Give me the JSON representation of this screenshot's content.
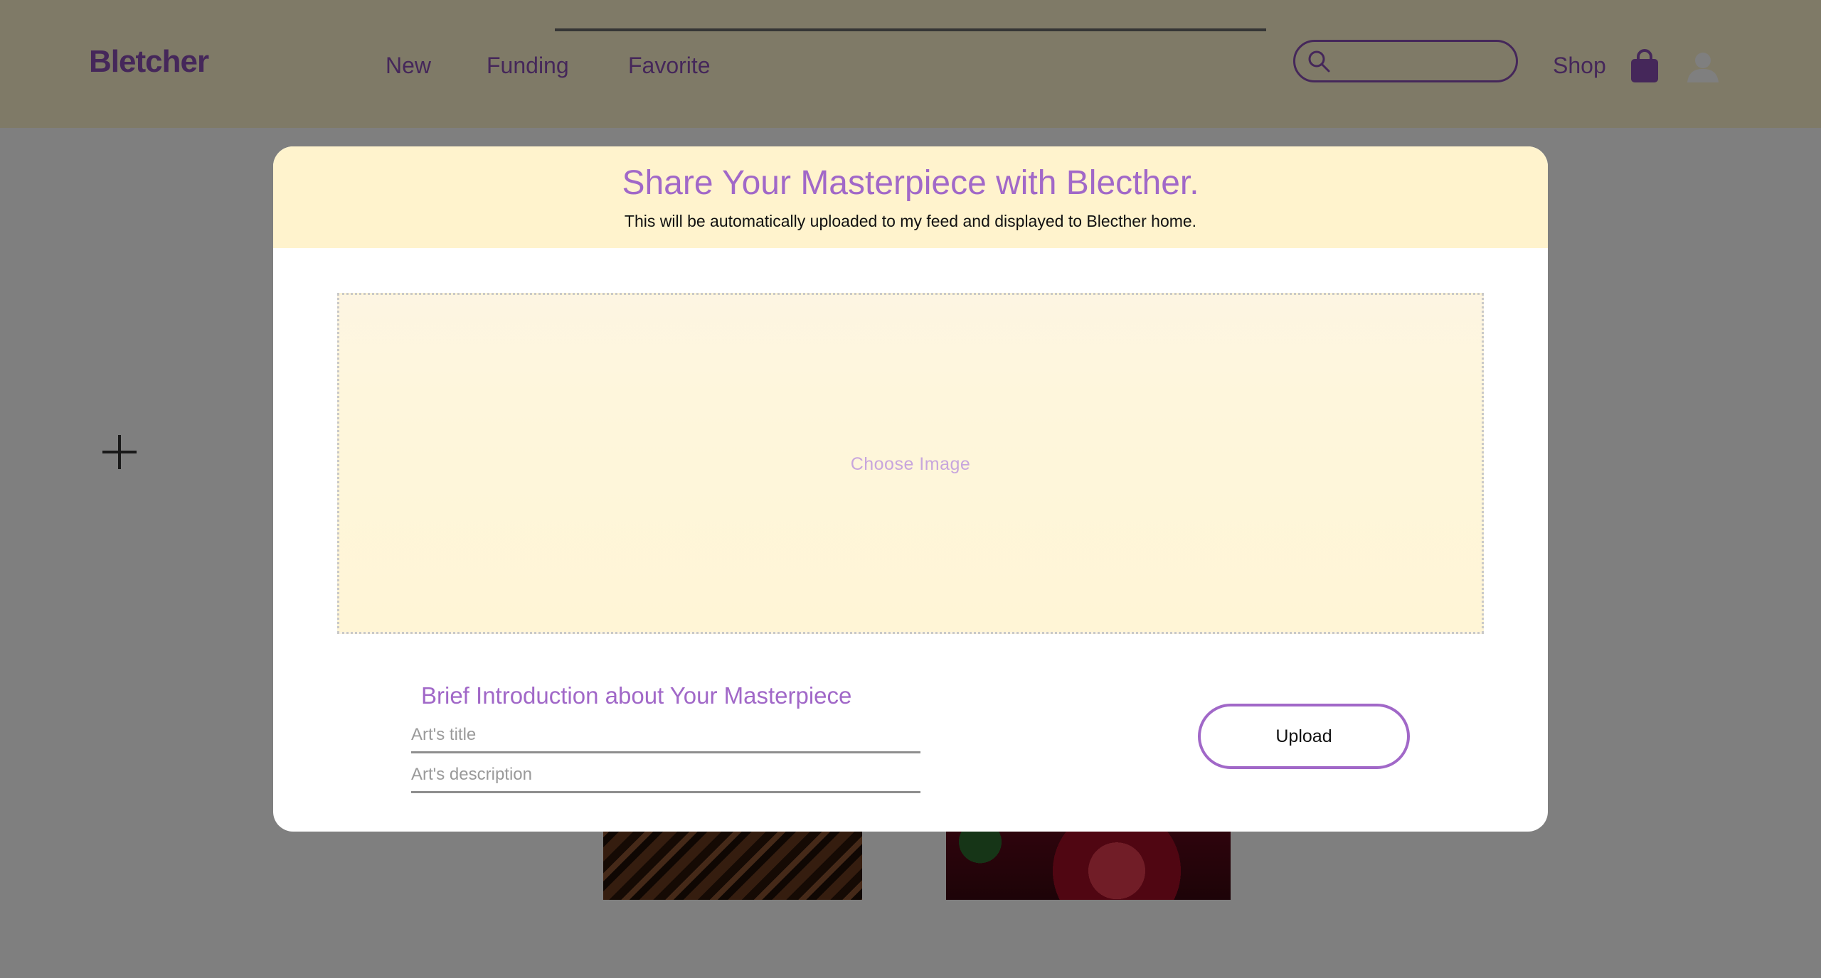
{
  "header": {
    "logo": "Bletcher",
    "nav": [
      "New",
      "Funding",
      "Favorite"
    ],
    "search": {
      "value": "",
      "placeholder": ""
    },
    "shop_label": "Shop",
    "icons": {
      "search": "search-icon",
      "bag": "shopping-bag-icon",
      "user": "user-avatar-icon"
    }
  },
  "page": {
    "add_icon": "plus-icon"
  },
  "modal": {
    "title": "Share Your Masterpiece with Blecther.",
    "subtitle": "This will be automatically uploaded to my feed and displayed to Blecther home.",
    "drop_zone_label": "Choose Image",
    "intro_heading": "Brief Introduction about Your Masterpiece",
    "title_field": {
      "value": "",
      "placeholder": "Art's title"
    },
    "description_field": {
      "value": "",
      "placeholder": "Art's description"
    },
    "upload_label": "Upload"
  },
  "colors": {
    "brand": "#8a4fb5",
    "accent": "#a168c8",
    "header_bg": "#fef4cf",
    "modal_header_bg": "#fff3cd"
  }
}
